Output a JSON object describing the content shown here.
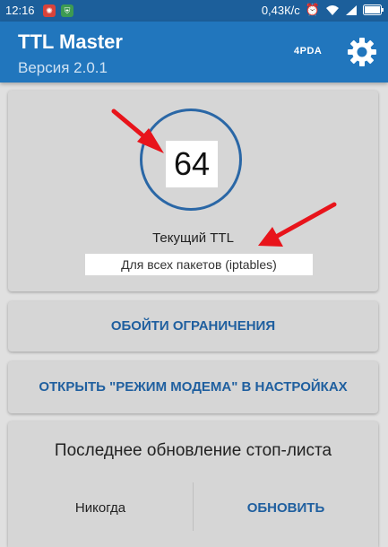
{
  "status_bar": {
    "time": "12:16",
    "speed": "0,43К/с"
  },
  "app_bar": {
    "title": "TTL Master",
    "version": "Версия 2.0.1",
    "logo_text": "4PDA"
  },
  "ttl_card": {
    "value": "64",
    "caption": "Текущий TTL",
    "mode": "Для всех пакетов (iptables)"
  },
  "buttons": {
    "bypass": "ОБОЙТИ ОГРАНИЧЕНИЯ",
    "open_modem": "ОТКРЫТЬ \"РЕЖИМ МОДЕМА\" В НАСТРОЙКАХ"
  },
  "update_card": {
    "title": "Последнее обновление стоп-листа",
    "last": "Никогда",
    "update_button": "ОБНОВИТЬ"
  },
  "colors": {
    "status_bar": "#1c5f9b",
    "app_bar": "#2176bd",
    "accent": "#1f5f9f",
    "annotation": "#e8141b"
  }
}
